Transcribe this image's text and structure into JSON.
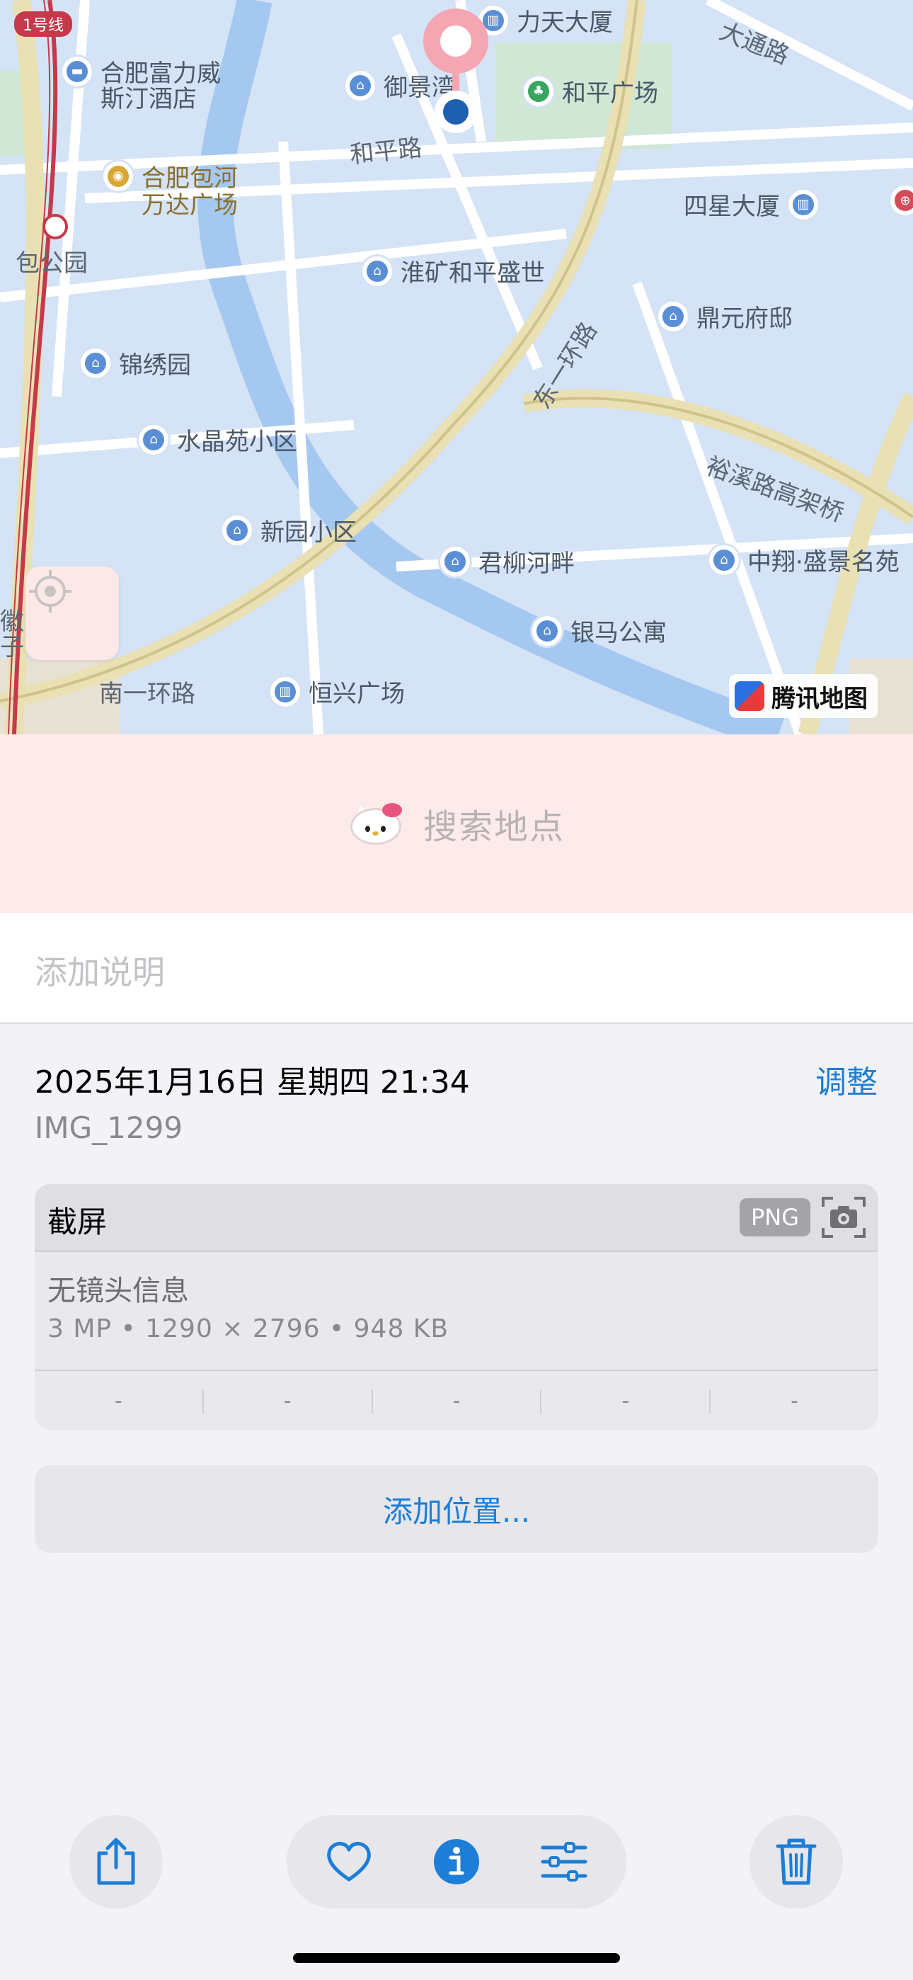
{
  "map": {
    "metro_line": "1号线",
    "road_labels": [
      "大通路",
      "和平路",
      "东一环路",
      "裕溪路高架桥",
      "南一环路",
      "包公园",
      "徽",
      "子"
    ],
    "pois": [
      {
        "name": "力天大厦",
        "icon": "building-icon"
      },
      {
        "name": "合肥富力威",
        "icon": "hotel-icon"
      },
      {
        "name": "斯汀酒店",
        "icon": "hotel-icon"
      },
      {
        "name": "御景湾",
        "icon": "home-icon"
      },
      {
        "name": "和平广场",
        "icon": "park-icon"
      },
      {
        "name": "合肥包河",
        "icon": "mall-icon"
      },
      {
        "name": "万达广场",
        "icon": "mall-icon"
      },
      {
        "name": "四星大厦",
        "icon": "building-icon"
      },
      {
        "name": "淮矿和平盛世",
        "icon": "home-icon"
      },
      {
        "name": "鼎元府邸",
        "icon": "home-icon"
      },
      {
        "name": "锦绣园",
        "icon": "home-icon"
      },
      {
        "name": "水晶苑小区",
        "icon": "home-icon"
      },
      {
        "name": "新园小区",
        "icon": "home-icon"
      },
      {
        "name": "君柳河畔",
        "icon": "home-icon"
      },
      {
        "name": "中翔·盛景名苑",
        "icon": "home-icon"
      },
      {
        "name": "银马公寓",
        "icon": "home-icon"
      },
      {
        "name": "恒兴广场",
        "icon": "building-icon"
      }
    ],
    "provider": "腾讯地图"
  },
  "search": {
    "placeholder": "搜索地点"
  },
  "caption": {
    "placeholder": "添加说明"
  },
  "details": {
    "datetime": "2025年1月16日 星期四 21:34",
    "adjust_label": "调整",
    "filename": "IMG_1299"
  },
  "info_card": {
    "title": "截屏",
    "format_badge": "PNG",
    "lens_info": "无镜头信息",
    "meta_line": "3 MP • 1290 × 2796 • 948 KB",
    "exif_values": [
      "-",
      "-",
      "-",
      "-",
      "-"
    ]
  },
  "add_location_label": "添加位置...",
  "colors": {
    "accent": "#1c7ed6",
    "search_bg": "#fdeaea",
    "pin": "#f4a7b2",
    "metro": "#c5394b"
  }
}
